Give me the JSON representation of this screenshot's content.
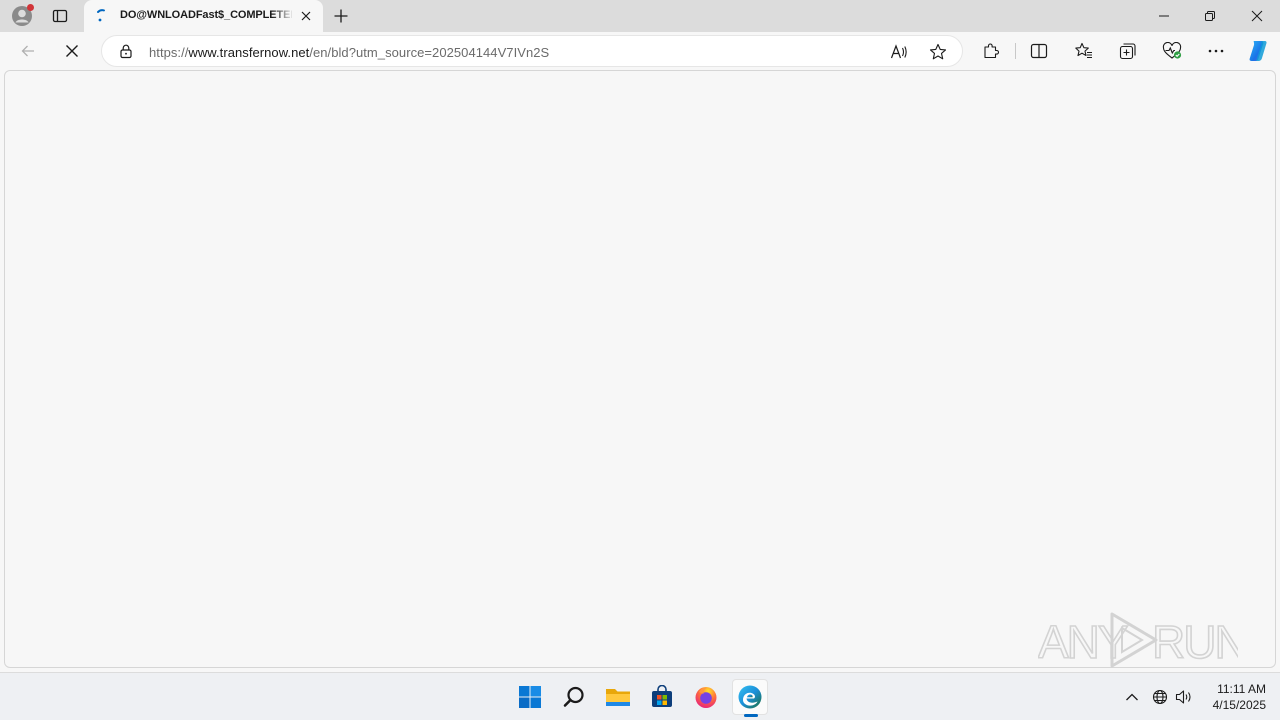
{
  "browser": {
    "tab": {
      "title": "DO@WNLOADFast$_COMPLETED",
      "state": "loading"
    },
    "address_bar": {
      "scheme": "https://",
      "host": "www.transfernow.net",
      "path": "/en/bld?utm_source=202504144V7IVn2S"
    },
    "colors": {
      "tabstrip": "#dcdcdc",
      "toolbar": "#f7f7f7",
      "notification_dot": "#d13438",
      "accent": "#0067c0"
    },
    "icons": {
      "profile": "profile-icon",
      "tab_actions": "tab-actions-icon",
      "loading": "loading-spinner-icon",
      "tab_close": "close-icon",
      "new_tab": "plus-icon",
      "minimize": "minimize-icon",
      "restore": "restore-icon",
      "close_window": "close-icon",
      "back": "back-arrow-icon",
      "stop": "stop-icon",
      "lock": "lock-icon",
      "read_aloud": "read-aloud-icon",
      "favorite": "star-icon",
      "extensions": "puzzle-icon",
      "split_screen": "split-screen-icon",
      "favorites": "favorites-icon",
      "collections": "collections-icon",
      "browser_essentials": "heart-pulse-icon",
      "more": "more-icon",
      "copilot": "copilot-icon"
    }
  },
  "watermark": {
    "text_left": "ANY",
    "text_right": "RUN"
  },
  "taskbar": {
    "apps": [
      "start-icon",
      "search-icon",
      "file-explorer-icon",
      "store-icon",
      "firefox-icon",
      "edge-icon"
    ],
    "tray": [
      "chevron-up-icon",
      "network-icon",
      "volume-icon"
    ],
    "clock": {
      "time": "11:11 AM",
      "date": "4/15/2025"
    }
  }
}
